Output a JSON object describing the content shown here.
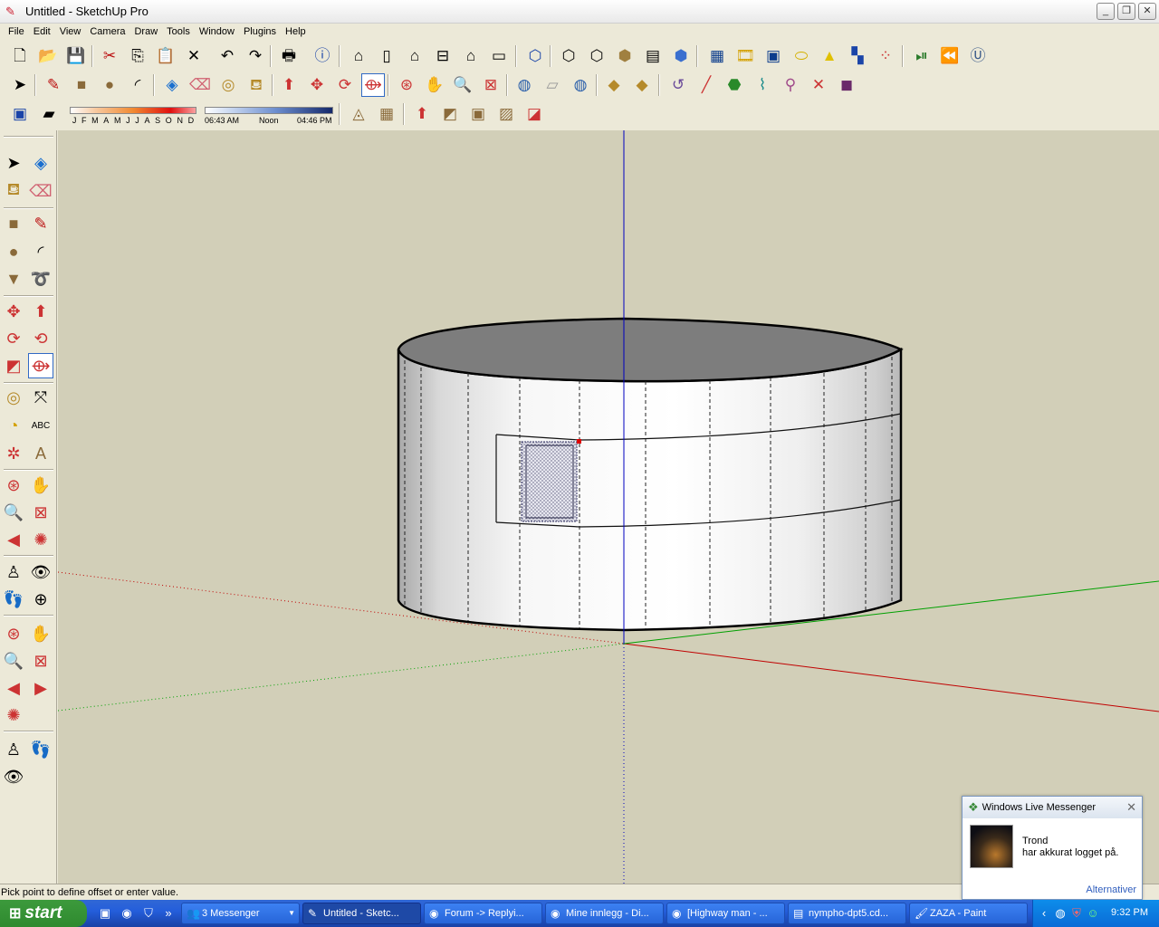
{
  "window": {
    "title": "Untitled - SketchUp Pro",
    "app_icon": "sketchup-icon",
    "controls": [
      "minimize",
      "maximize",
      "close"
    ]
  },
  "menu": [
    "File",
    "Edit",
    "View",
    "Camera",
    "Draw",
    "Tools",
    "Window",
    "Plugins",
    "Help"
  ],
  "shadow_settings": {
    "months": [
      "J",
      "F",
      "M",
      "A",
      "M",
      "J",
      "J",
      "A",
      "S",
      "O",
      "N",
      "D"
    ],
    "sunrise": "06:43 AM",
    "noon": "Noon",
    "sunset": "04:46 PM"
  },
  "viewport": {
    "background": "#d2cfb8",
    "model": "cylinder",
    "axis_colors": {
      "red": "#c00000",
      "green": "#00a000",
      "blue": "#0000c0"
    }
  },
  "status": {
    "text": "Pick point to define offset or enter value."
  },
  "taskbar": {
    "start_label": "start",
    "tasks": [
      {
        "label": "3 Messenger",
        "icon": "messenger-icon"
      },
      {
        "label": "Untitled - Sketc...",
        "icon": "sketchup-icon"
      },
      {
        "label": "Forum -> Replyi...",
        "icon": "firefox-icon"
      },
      {
        "label": "Mine innlegg - Di...",
        "icon": "firefox-icon"
      },
      {
        "label": "[Highway man - ...",
        "icon": "firefox-icon"
      },
      {
        "label": "nympho-dpt5.cd...",
        "icon": "winrar-icon"
      },
      {
        "label": "ZAZA - Paint",
        "icon": "paint-icon"
      }
    ],
    "clock": "9:32 PM"
  },
  "toast": {
    "app": "Windows Live Messenger",
    "name": "Trond",
    "message": "har akkurat logget på.",
    "link": "Alternativer"
  }
}
